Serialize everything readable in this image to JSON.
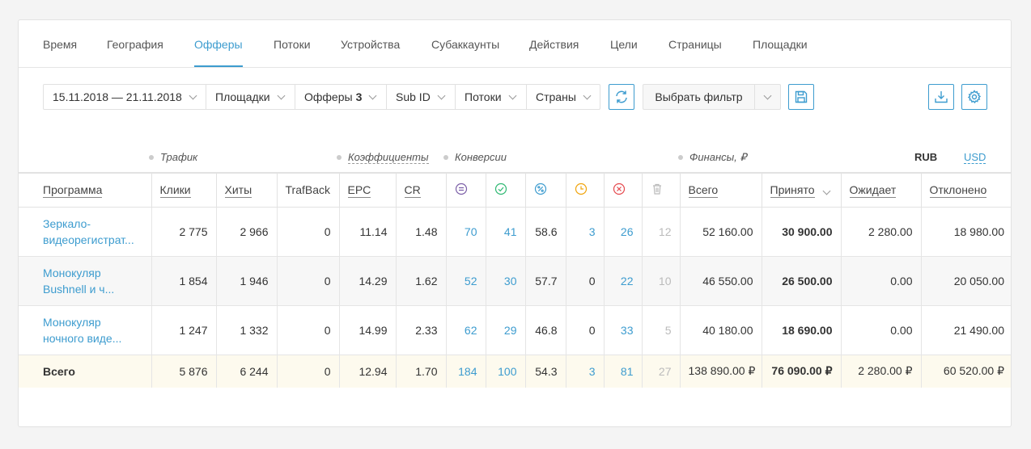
{
  "tabs": [
    {
      "label": "Время",
      "active": false
    },
    {
      "label": "География",
      "active": false
    },
    {
      "label": "Офферы",
      "active": true
    },
    {
      "label": "Потоки",
      "active": false
    },
    {
      "label": "Устройства",
      "active": false
    },
    {
      "label": "Субаккаунты",
      "active": false
    },
    {
      "label": "Действия",
      "active": false
    },
    {
      "label": "Цели",
      "active": false
    },
    {
      "label": "Страницы",
      "active": false
    },
    {
      "label": "Площадки",
      "active": false
    }
  ],
  "toolbar": {
    "date_range": "15.11.2018 — 21.11.2018",
    "platforms": "Площадки",
    "offers": "Офферы",
    "offers_count": "3",
    "sub_id": "Sub ID",
    "flows": "Потоки",
    "countries": "Страны",
    "select_filter": "Выбрать фильтр",
    "refresh_icon": "refresh-icon",
    "save_icon": "floppy-disk-icon",
    "export_icon": "download-tray-icon",
    "settings_icon": "gear-icon"
  },
  "groups": {
    "traffic": "Трафик",
    "coefficients": "Коэффициенты",
    "conversions": "Конверсии",
    "finance": "Финансы, ₽"
  },
  "currency": {
    "rub": "RUB",
    "usd": "USD",
    "selected": "RUB"
  },
  "colors": {
    "accent": "#3d9ccf",
    "total_row_bg": "#fdfaee",
    "approved_icon": "#2eb872",
    "pending_icon": "#f0a30a",
    "rejected_icon": "#e5484d",
    "all_icon": "#7b5ea7",
    "percent_icon": "#3d9ccf"
  },
  "table": {
    "headers": {
      "program": "Программа",
      "clicks": "Клики",
      "hits": "Хиты",
      "trafback": "TrafBack",
      "epc": "EPC",
      "cr": "CR",
      "total": "Всего",
      "accepted": "Принято",
      "pending": "Ожидает",
      "rejected": "Отклонено"
    },
    "conversion_icons": [
      "all-conversions-icon",
      "approved-check-icon",
      "percent-icon",
      "pending-clock-icon",
      "rejected-x-icon",
      "trash-icon"
    ],
    "rows": [
      {
        "program": "Зеркало-видеорегистрат...",
        "clicks": "2 775",
        "hits": "2 966",
        "trafback": "0",
        "epc": "11.14",
        "cr": "1.48",
        "conv_all": "70",
        "conv_ok": "41",
        "conv_pct": "58.6",
        "conv_wait": "3",
        "conv_rej": "26",
        "conv_trash": "12",
        "fin_total": "52 160.00",
        "fin_accepted": "30 900.00",
        "fin_pending": "2 280.00",
        "fin_rejected": "18 980.00"
      },
      {
        "program": "Монокуляр Bushnell и ч...",
        "clicks": "1 854",
        "hits": "1 946",
        "trafback": "0",
        "epc": "14.29",
        "cr": "1.62",
        "conv_all": "52",
        "conv_ok": "30",
        "conv_pct": "57.7",
        "conv_wait": "0",
        "conv_rej": "22",
        "conv_trash": "10",
        "fin_total": "46 550.00",
        "fin_accepted": "26 500.00",
        "fin_pending": "0.00",
        "fin_rejected": "20 050.00"
      },
      {
        "program": "Монокуляр ночного виде...",
        "clicks": "1 247",
        "hits": "1 332",
        "trafback": "0",
        "epc": "14.99",
        "cr": "2.33",
        "conv_all": "62",
        "conv_ok": "29",
        "conv_pct": "46.8",
        "conv_wait": "0",
        "conv_rej": "33",
        "conv_trash": "5",
        "fin_total": "40 180.00",
        "fin_accepted": "18 690.00",
        "fin_pending": "0.00",
        "fin_rejected": "21 490.00"
      }
    ],
    "total": {
      "program": "Всего",
      "clicks": "5 876",
      "hits": "6 244",
      "trafback": "0",
      "epc": "12.94",
      "cr": "1.70",
      "conv_all": "184",
      "conv_ok": "100",
      "conv_pct": "54.3",
      "conv_wait": "3",
      "conv_rej": "81",
      "conv_trash": "27",
      "fin_total": "138 890.00 ₽",
      "fin_accepted": "76 090.00 ₽",
      "fin_pending": "2 280.00 ₽",
      "fin_rejected": "60 520.00 ₽"
    }
  }
}
